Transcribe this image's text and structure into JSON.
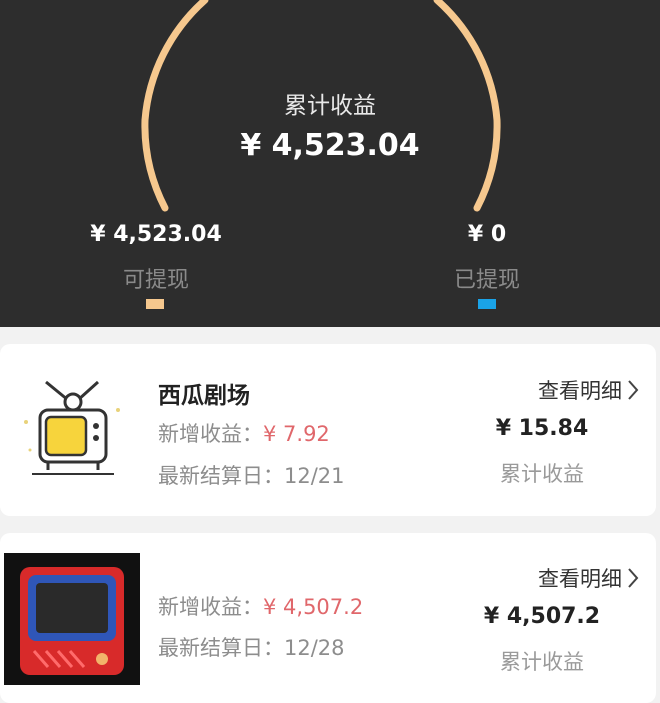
{
  "summary": {
    "total_label": "累计收益",
    "total_value": "¥ 4,523.04",
    "withdrawable": {
      "value": "¥ 4,523.04",
      "label": "可提现",
      "color": "#f6c88e"
    },
    "withdrawn": {
      "value": "¥ 0",
      "label": "已提现",
      "color": "#1aa3e8"
    },
    "arc_color": "#f6c88e"
  },
  "items": [
    {
      "icon": "retro-tv-icon",
      "name": "西瓜剧场",
      "new_income_label": "新增收益：",
      "new_income_value": "¥ 7.92",
      "settle_label": "最新结算日：",
      "settle_date": "12/21",
      "detail_label": "查看明细",
      "amount": "¥ 15.84",
      "amount_label": "累计收益"
    },
    {
      "icon": "red-tv-icon",
      "name": "",
      "new_income_label": "新增收益：",
      "new_income_value": "¥ 4,507.2",
      "settle_label": "最新结算日：",
      "settle_date": "12/28",
      "detail_label": "查看明细",
      "amount": "¥ 4,507.2",
      "amount_label": "累计收益"
    }
  ]
}
